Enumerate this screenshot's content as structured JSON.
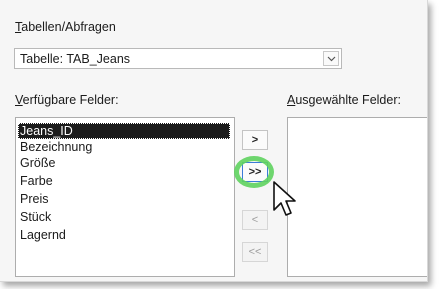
{
  "tables_label": {
    "accel": "T",
    "rest": "abellen/Abfragen"
  },
  "table_select": {
    "value": "Tabelle: TAB_Jeans"
  },
  "available_label": {
    "accel": "V",
    "rest": "erfügbare Felder:"
  },
  "selected_label": {
    "accel": "A",
    "rest": "usgewählte Felder:"
  },
  "available_fields": [
    "Jeans_ID",
    "Bezeichnung",
    "Größe",
    "Farbe",
    "Preis",
    "Stück",
    "Lagernd"
  ],
  "selected_fields": [],
  "buttons": {
    "add": ">",
    "add_all": ">>",
    "remove": "<",
    "remove_all": "<<"
  },
  "colors": {
    "highlight_ring": "#5fd35f",
    "selection_bg": "#1c1c1c",
    "focus_border": "#3b7bd8"
  }
}
